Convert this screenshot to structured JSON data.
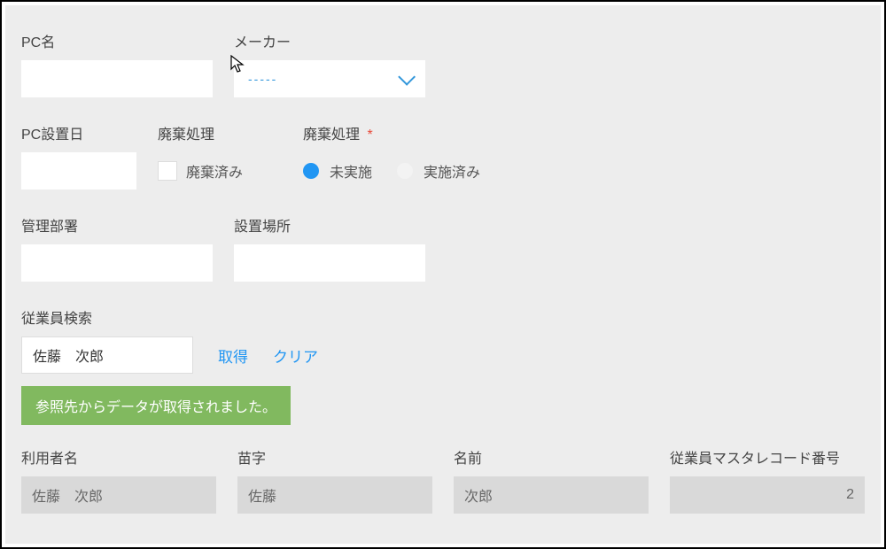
{
  "labels": {
    "pc_name": "PC名",
    "maker": "メーカー",
    "pc_install_date": "PC設置日",
    "disposal_process": "廃棄処理",
    "disposal_process_req": "廃棄処理",
    "management_dept": "管理部署",
    "install_location": "設置場所",
    "employee_search": "従業員検索",
    "user_name": "利用者名",
    "last_name": "苗字",
    "first_name": "名前",
    "employee_master_record_no": "従業員マスタレコード番号"
  },
  "dropdown": {
    "placeholder": "-----"
  },
  "checkbox": {
    "disposed_label": "廃棄済み"
  },
  "radio": {
    "options": [
      {
        "label": "未実施",
        "selected": true
      },
      {
        "label": "実施済み",
        "selected": false
      }
    ]
  },
  "search": {
    "value": "佐藤　次郎",
    "fetch_btn": "取得",
    "clear_btn": "クリア"
  },
  "banner": {
    "text": "参照先からデータが取得されました。"
  },
  "result": {
    "user_name": "佐藤　次郎",
    "last_name": "佐藤",
    "first_name": "次郎",
    "record_no": "2"
  }
}
